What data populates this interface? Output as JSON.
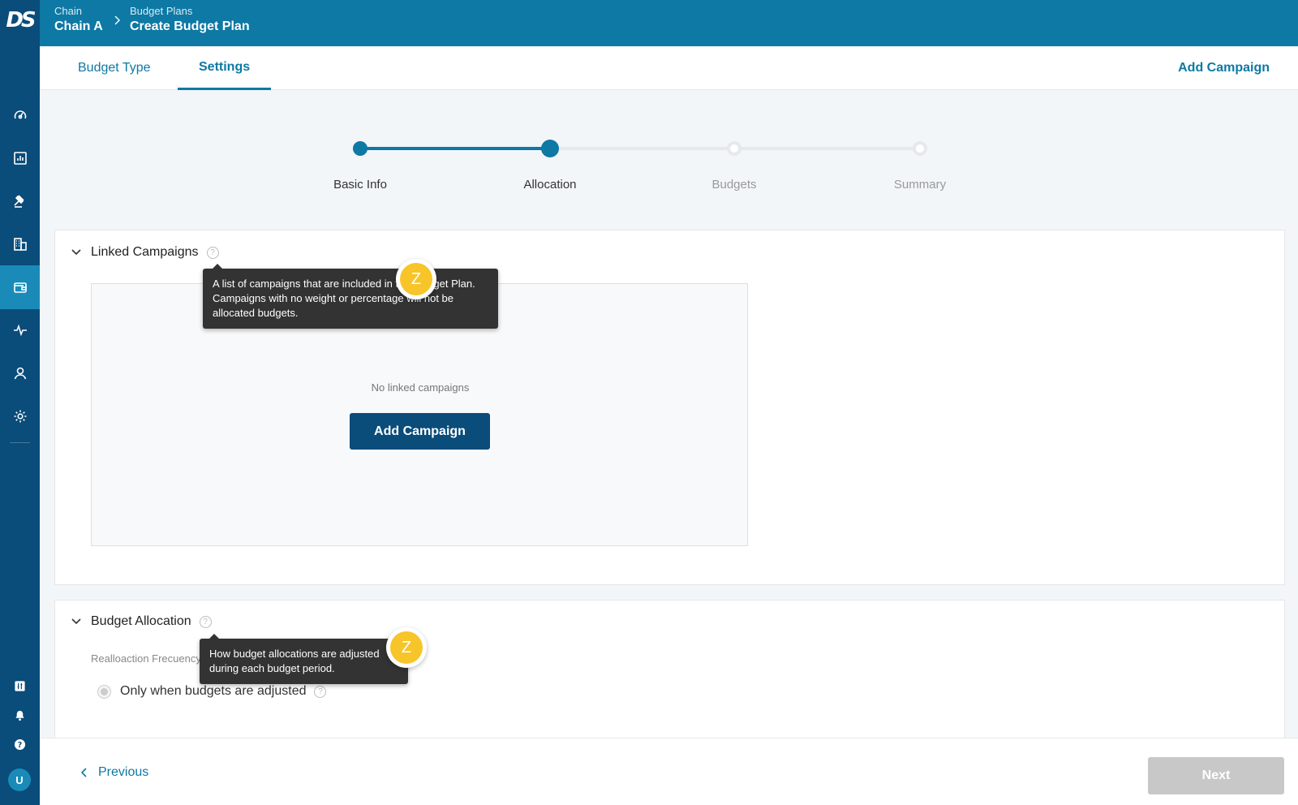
{
  "app": {
    "logo_text": "DS"
  },
  "header": {
    "breadcrumbs": [
      {
        "caption": "Chain",
        "title": "Chain A"
      },
      {
        "caption": "Budget Plans",
        "title": "Create Budget Plan"
      }
    ]
  },
  "tabs": [
    {
      "label": "Budget Type",
      "active": false
    },
    {
      "label": "Settings",
      "active": true
    }
  ],
  "tabbar_action": "Add Campaign",
  "stepper": {
    "steps": [
      {
        "label": "Basic Info",
        "state": "done"
      },
      {
        "label": "Allocation",
        "state": "current"
      },
      {
        "label": "Budgets",
        "state": "todo"
      },
      {
        "label": "Summary",
        "state": "todo"
      }
    ]
  },
  "linked_campaigns": {
    "title": "Linked Campaigns",
    "tooltip": "A list of campaigns that are included in this Budget Plan. Campaigns with no weight or percentage will not be allocated budgets.",
    "empty_text": "No linked campaigns",
    "add_button": "Add Campaign"
  },
  "budget_allocation": {
    "title": "Budget Allocation",
    "tooltip": "How budget allocations are adjusted during each budget period.",
    "field_label": "Realloaction Frecuency",
    "option": "Only when budgets are adjusted"
  },
  "guide_badge": "Z",
  "footer": {
    "previous": "Previous",
    "next": "Next"
  },
  "colors": {
    "sidebar": "#0a4c7a",
    "header": "#0d79a4",
    "accent": "#0d79a4",
    "badge": "#f7c52a",
    "disabled": "#c8c8c8"
  },
  "sidebar_icons": [
    "dashboard-icon",
    "reports-icon",
    "auction-icon",
    "buildings-icon",
    "wallet-icon",
    "activity-icon",
    "user-icon",
    "settings-icon",
    "integrations-icon",
    "bell-icon",
    "help-icon"
  ],
  "user": {
    "initial": "U"
  }
}
